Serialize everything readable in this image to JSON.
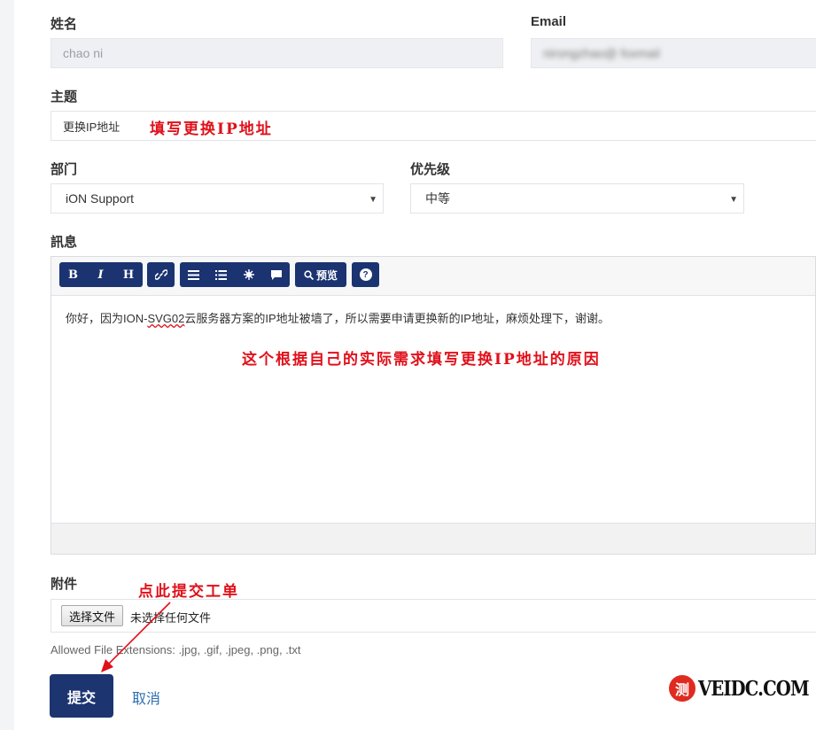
{
  "form": {
    "name_label": "姓名",
    "name_value": "chao ni",
    "email_label": "Email",
    "email_value": "nirongzhao@ foxmail",
    "subject_label": "主题",
    "subject_value": "更换IP地址",
    "department_label": "部门",
    "department_value": "iON Support",
    "priority_label": "优先级",
    "priority_value": "中等",
    "message_label": "訊息",
    "message_text_before": "你好，因为ION-",
    "message_text_err": "SVG02",
    "message_text_after": "云服务器方案的IP地址被墙了，所以需要申请更换新的IP地址，麻烦处理下，谢谢。",
    "attachment_label": "附件",
    "file_button_label": "选择文件",
    "file_status": "未选择任何文件",
    "allowed_extensions": "Allowed File Extensions: .jpg, .gif, .jpeg, .png, .txt",
    "submit_label": "提交",
    "cancel_label": "取消"
  },
  "toolbar": {
    "bold": "B",
    "italic": "I",
    "heading": "H",
    "preview": "预览",
    "help": "?"
  },
  "annotations": {
    "subject_hint": "填写更换IP地址",
    "message_hint": "这个根据自己的实际需求填写更换IP地址的原因",
    "submit_hint": "点此提交工单"
  },
  "watermark": {
    "circle_char": "测",
    "text": "VEIDC.COM"
  },
  "icons": [
    "link-icon",
    "ordered-list-icon",
    "unordered-list-icon",
    "image-icon",
    "quote-icon",
    "search-icon",
    "help-icon",
    "dropdown-arrow-icon"
  ],
  "colors": {
    "primary": "#1c3571",
    "annotation": "#e0101a",
    "link": "#2f6fb0"
  }
}
